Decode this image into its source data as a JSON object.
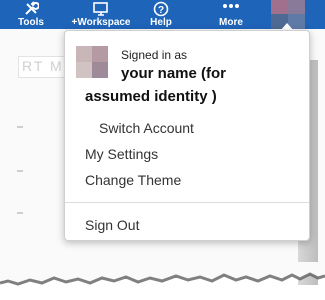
{
  "toolbar": {
    "items": [
      {
        "label": "Tools",
        "icon": "tools-icon"
      },
      {
        "label": "+Workspace",
        "icon": "monitor-icon"
      },
      {
        "label": "Help",
        "icon": "help-icon"
      },
      {
        "label": "More",
        "icon": "more-dots-icon"
      }
    ],
    "background": "#1e64b9"
  },
  "background_page": {
    "field_text": "RT M"
  },
  "account_menu": {
    "signed_in_label": "Signed in as",
    "user_name_line1": "your name   (for",
    "user_name_line2": "assumed identity  )",
    "items": [
      {
        "label": "Switch Account"
      },
      {
        "label": "My Settings"
      },
      {
        "label": "Change Theme"
      },
      {
        "label": "Sign Out"
      }
    ]
  }
}
